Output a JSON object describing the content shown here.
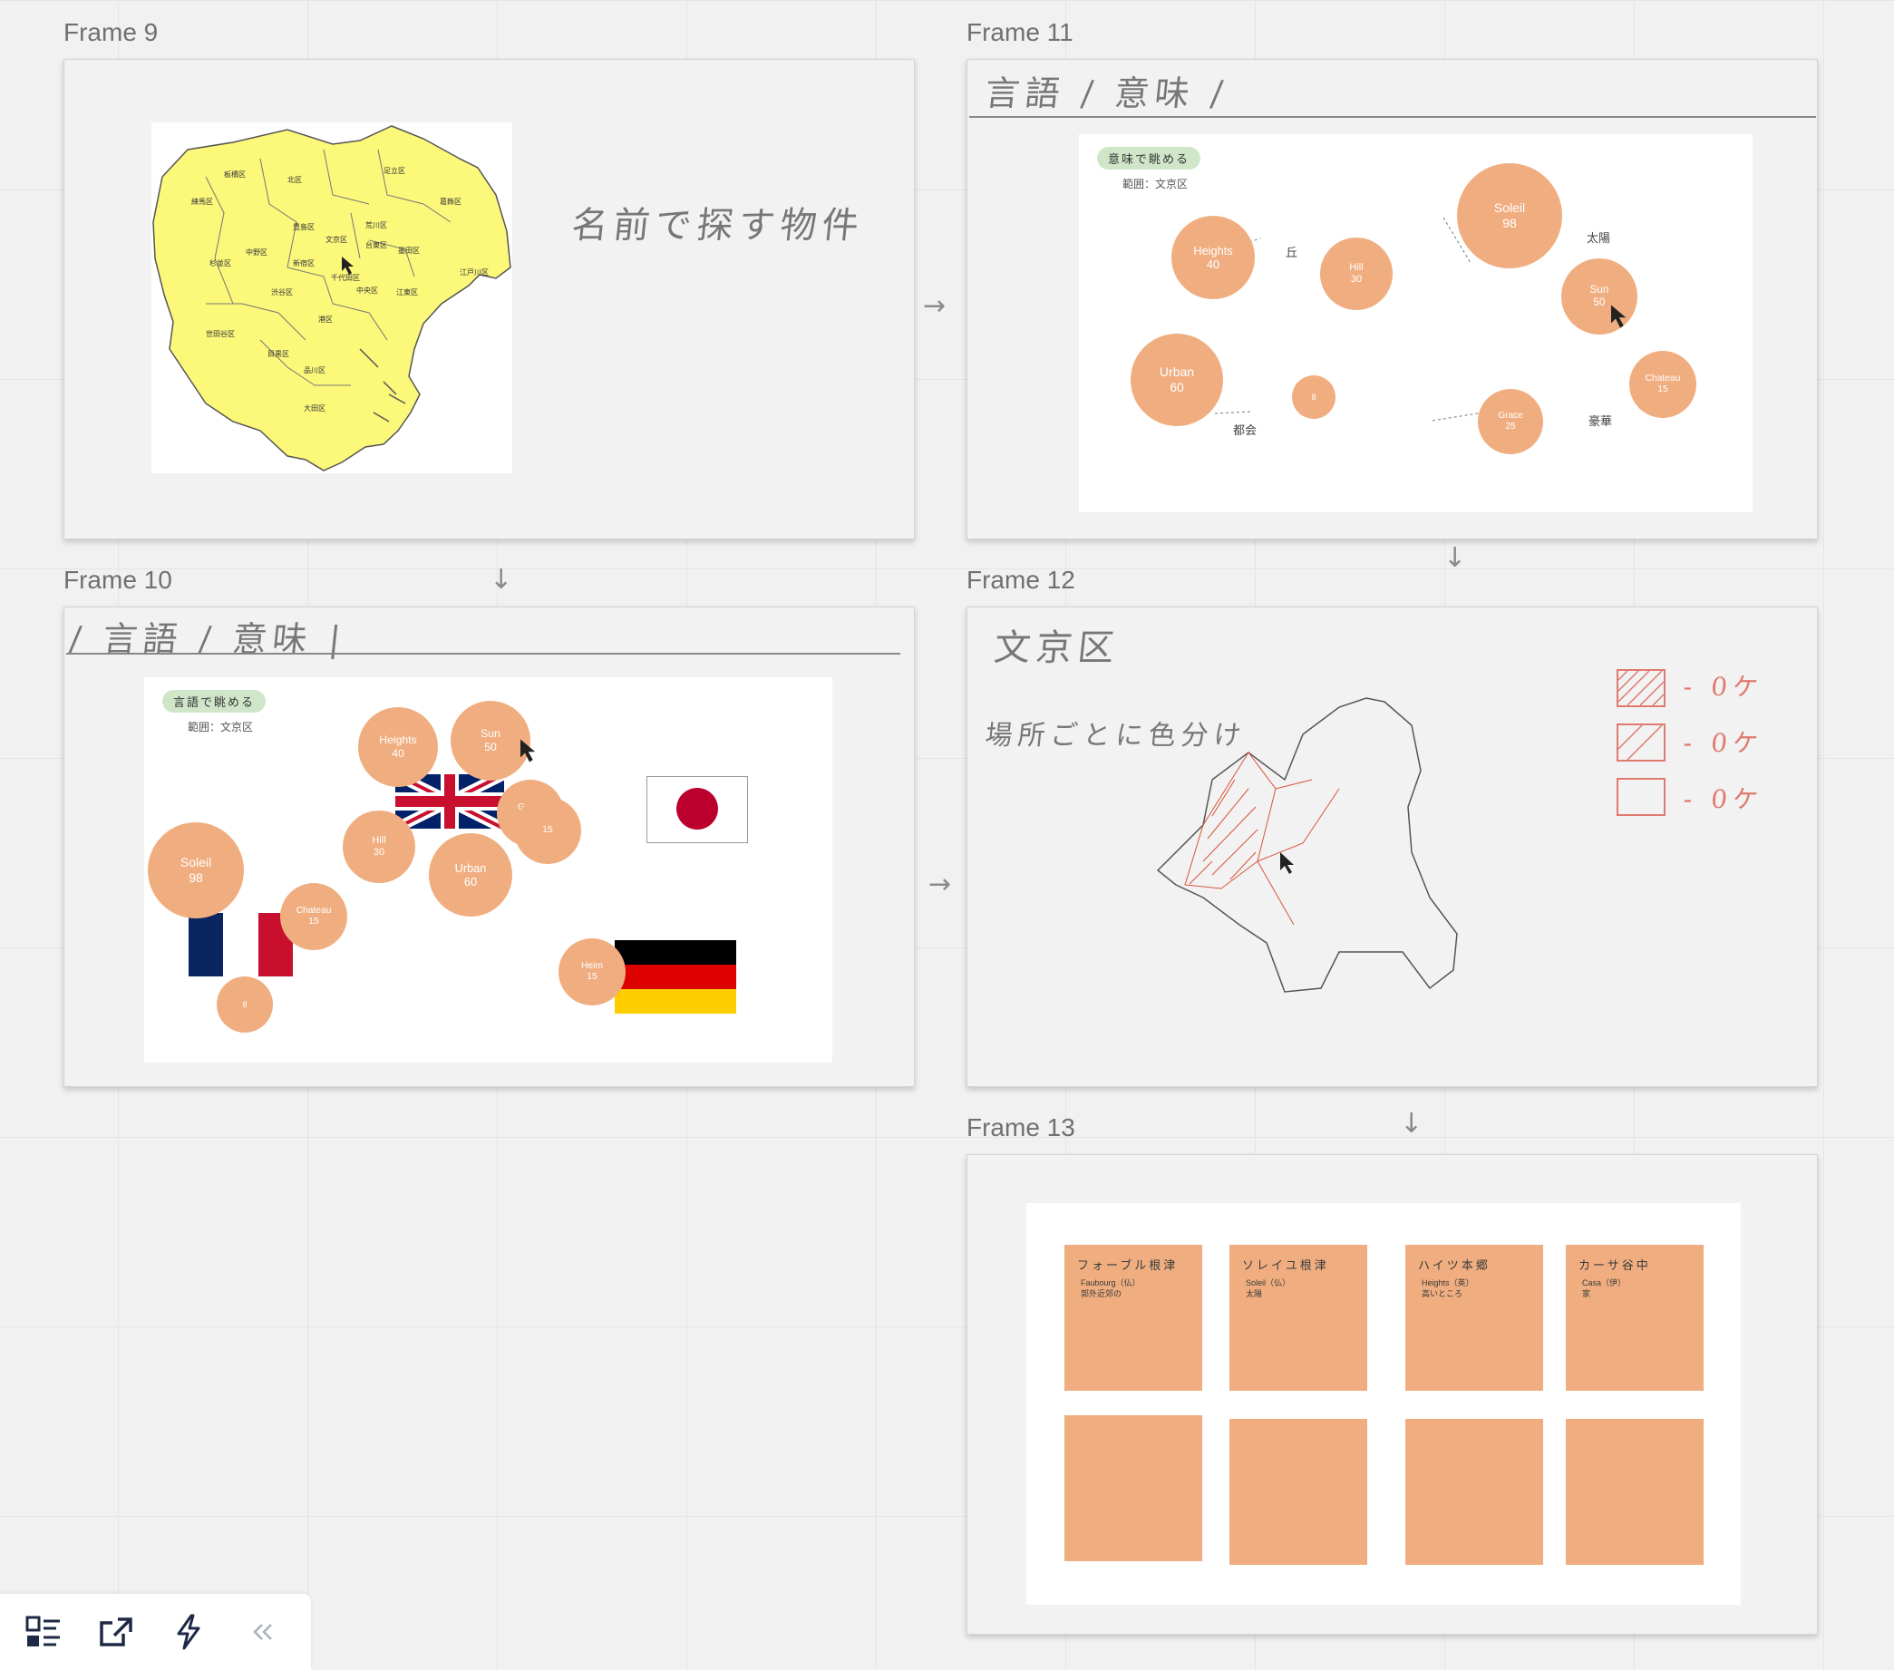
{
  "frames": {
    "f9": {
      "label": "Frame 9",
      "note": "名前で探す物件"
    },
    "f11": {
      "label": "Frame 11",
      "header": "言語 / 意味 /",
      "pill": "意味で眺める",
      "scope": "範囲：文京区"
    },
    "f10": {
      "label": "Frame 10",
      "header": "/ 言語 / 意味 |",
      "pill": "言語で眺める",
      "scope": "範囲：文京区"
    },
    "f12": {
      "label": "Frame 12",
      "title": "文京区",
      "note": "場所ごとに色分け",
      "legend": [
        "- 0ケ",
        "- 0ケ",
        "- 0ケ"
      ]
    },
    "f13": {
      "label": "Frame 13"
    }
  },
  "map_wards": [
    "練馬区",
    "板橋区",
    "北区",
    "足立区",
    "葛飾区",
    "荒川区",
    "豊島区",
    "文京区",
    "台東区",
    "墨田区",
    "中野区",
    "杉並区",
    "新宿区",
    "江戸川区",
    "千代田区",
    "渋谷区",
    "中央区",
    "江東区",
    "港区",
    "世田谷区",
    "目黒区",
    "品川区",
    "大田区"
  ],
  "bubbles11": [
    {
      "name": "Heights",
      "value": "40"
    },
    {
      "name": "Hill",
      "value": "30"
    },
    {
      "name": "Soleil",
      "value": "98"
    },
    {
      "name": "Sun",
      "value": "50"
    },
    {
      "name": "Urban",
      "value": "60"
    },
    {
      "name": "",
      "value": "8"
    },
    {
      "name": "Chateau",
      "value": "15"
    },
    {
      "name": "Grace",
      "value": "25"
    }
  ],
  "links11": [
    "丘",
    "太陽",
    "都会",
    "豪華"
  ],
  "bubbles10": [
    {
      "name": "Heights",
      "value": "40"
    },
    {
      "name": "Sun",
      "value": "50"
    },
    {
      "name": "Grace",
      "value": "25"
    },
    {
      "name": "Hill",
      "value": "30"
    },
    {
      "name": "Urban",
      "value": "60"
    },
    {
      "name": "Soleil",
      "value": "98"
    },
    {
      "name": "Chateau",
      "value": "15"
    },
    {
      "name": "",
      "value": "8"
    },
    {
      "name": "Heim",
      "value": "15"
    },
    {
      "name": "",
      "value": "15"
    }
  ],
  "cards": [
    {
      "title": "フォーブル根津",
      "sub1": "Faubourg（仏）",
      "sub2": "郭外近郊の"
    },
    {
      "title": "ソレイユ根津",
      "sub1": "Soleil（仏）",
      "sub2": "太陽"
    },
    {
      "title": "ハイツ本郷",
      "sub1": "Heights（英）",
      "sub2": "高いところ"
    },
    {
      "title": "カーサ谷中",
      "sub1": "Casa（伊）",
      "sub2": "家"
    }
  ],
  "toolbar": {
    "icons": [
      "frames-list-icon",
      "share-export-icon",
      "lightning-icon",
      "collapse-chevrons-icon"
    ]
  },
  "colors": {
    "bubble": "#f0ae80",
    "map": "#fbf87a",
    "pill": "#cfe7c8"
  }
}
